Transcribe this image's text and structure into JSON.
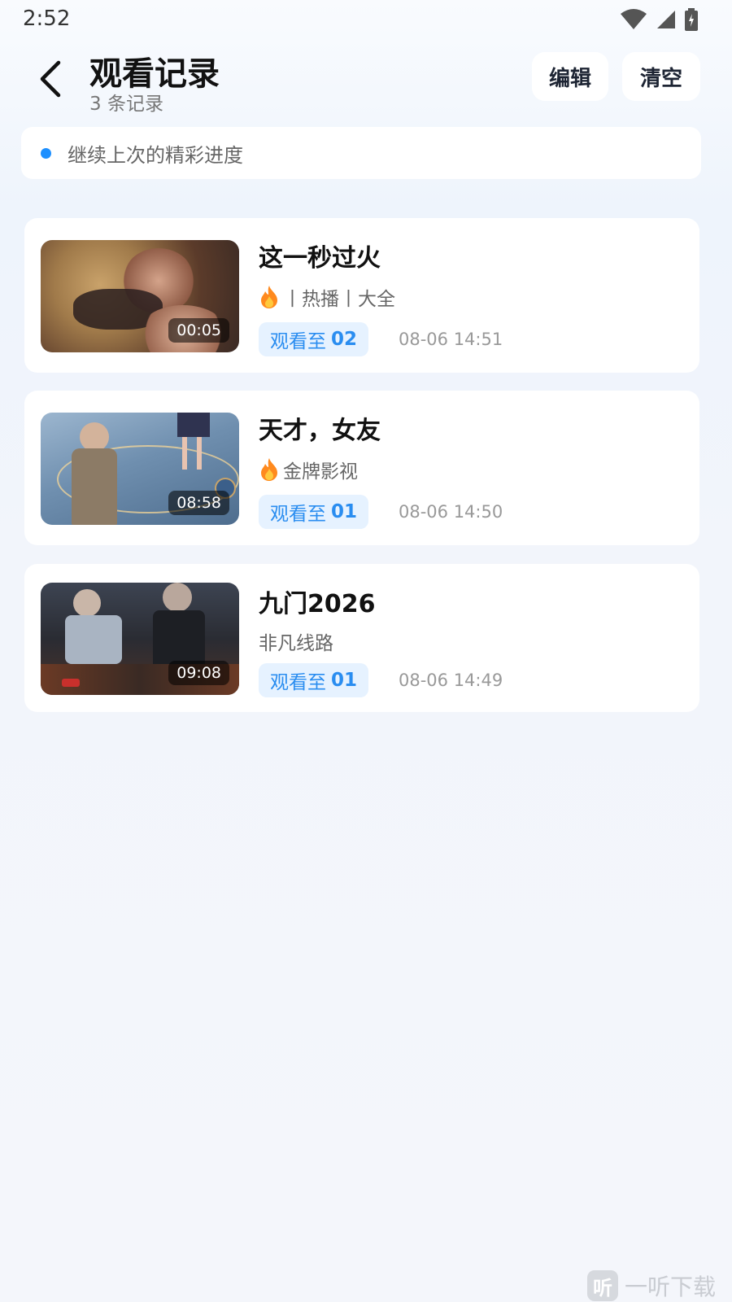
{
  "status_bar": {
    "time": "2:52",
    "icons": [
      "wifi-icon",
      "signal-icon",
      "battery-icon"
    ]
  },
  "header": {
    "title": "观看记录",
    "subtitle": "3 条记录",
    "edit_label": "编辑",
    "clear_label": "清空"
  },
  "tip": {
    "text": "继续上次的精彩进度"
  },
  "records": [
    {
      "title": "这一秒过火",
      "tags": "丨热播丨大全",
      "has_fire": true,
      "duration": "00:05",
      "progress_prefix": "观看至",
      "episode": "02",
      "timestamp": "08-06 14:51"
    },
    {
      "title": "天才，女友",
      "tags": "金牌影视",
      "has_fire": true,
      "duration": "08:58",
      "progress_prefix": "观看至",
      "episode": "01",
      "timestamp": "08-06 14:50"
    },
    {
      "title": "九门2026",
      "tags": "非凡线路",
      "has_fire": false,
      "duration": "09:08",
      "progress_prefix": "观看至",
      "episode": "01",
      "timestamp": "08-06 14:49"
    }
  ],
  "watermark": {
    "logo": "听",
    "text": "一听下载"
  },
  "colors": {
    "accent": "#2a8df0",
    "badge_bg": "#e6f2ff",
    "tip_dot": "#1e90ff"
  }
}
